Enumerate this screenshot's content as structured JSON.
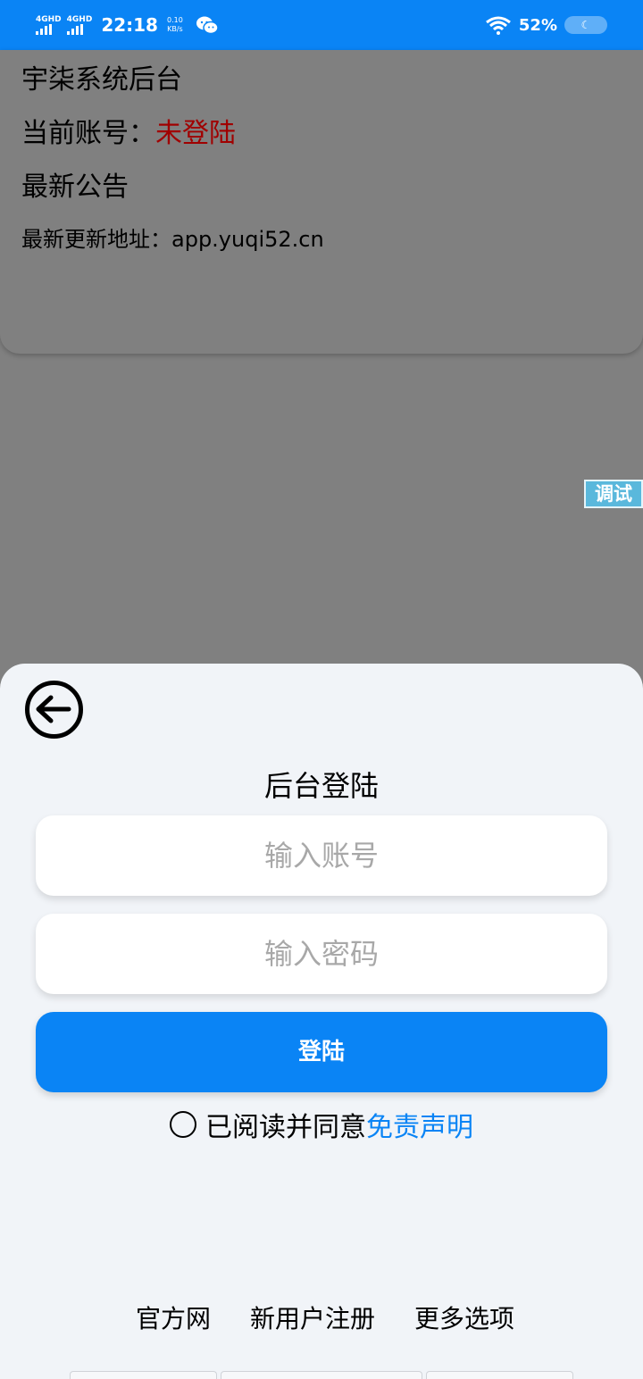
{
  "status_bar": {
    "signal1": "4GHD",
    "signal2": "4GHD",
    "time": "22:18",
    "speed_value": "0.10",
    "speed_unit": "KB/s",
    "battery": "52%",
    "app_icon": "wechat-icon"
  },
  "info_card": {
    "title": "宇柒系统后台",
    "account_label": "当前账号：",
    "account_status": "未登陆",
    "notice_title": "最新公告",
    "notice_text": "最新更新地址：app.yuqi52.cn"
  },
  "debug_button": "调试",
  "sheet": {
    "title": "后台登陆",
    "account_placeholder": "输入账号",
    "password_placeholder": "输入密码",
    "login_button": "登陆",
    "agree_text": "已阅读并同意",
    "agree_link": "免责声明",
    "footer": {
      "official_site": "官方网",
      "register": "新用户注册",
      "more_options": "更多选项"
    }
  },
  "colors": {
    "accent": "#0a84f5",
    "overlay": "#808080",
    "sheet_bg": "#f1f4f8",
    "warning_red": "#a00000",
    "debug_bg": "#5ab8dc"
  }
}
